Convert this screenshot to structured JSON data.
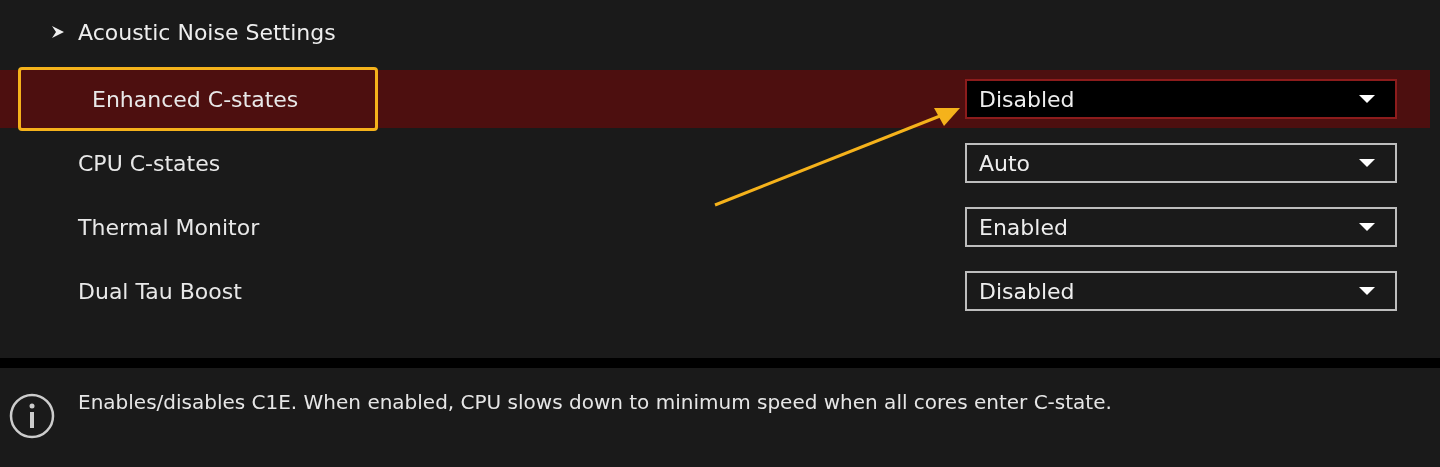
{
  "submenu": {
    "label": "Acoustic Noise Settings"
  },
  "settings": [
    {
      "label": "Enhanced C-states",
      "value": "Disabled",
      "selected": true,
      "highlighted": true
    },
    {
      "label": "CPU C-states",
      "value": "Auto",
      "selected": false,
      "highlighted": false
    },
    {
      "label": "Thermal Monitor",
      "value": "Enabled",
      "selected": false,
      "highlighted": false
    },
    {
      "label": "Dual Tau Boost",
      "value": "Disabled",
      "selected": false,
      "highlighted": false
    }
  ],
  "help": {
    "text": "Enables/disables C1E. When enabled, CPU slows down to minimum speed when all cores enter C-state."
  },
  "annotation": {
    "arrow": true
  }
}
